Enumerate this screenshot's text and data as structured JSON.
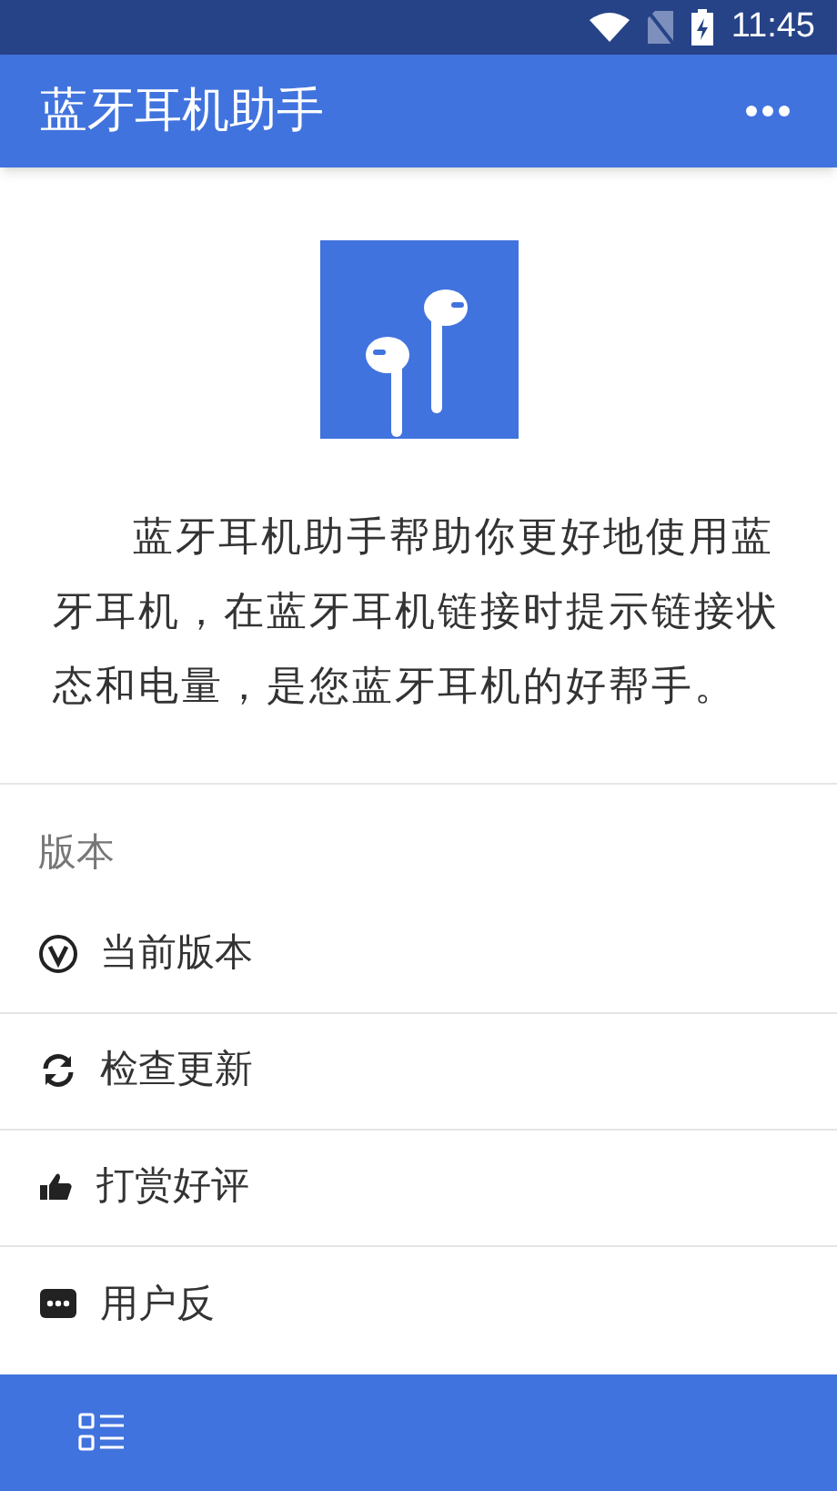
{
  "status_bar": {
    "time": "11:45"
  },
  "app_bar": {
    "title": "蓝牙耳机助手"
  },
  "description": "蓝牙耳机助手帮助你更好地使用蓝牙耳机，在蓝牙耳机链接时提示链接状态和电量，是您蓝牙耳机的好帮手。",
  "section": {
    "title": "版本",
    "items": [
      {
        "kind": "version",
        "label": "当前版本"
      },
      {
        "kind": "update",
        "label": "检查更新"
      },
      {
        "kind": "like",
        "label": "打赏好评"
      },
      {
        "kind": "feedback",
        "label": "用户反"
      }
    ]
  }
}
